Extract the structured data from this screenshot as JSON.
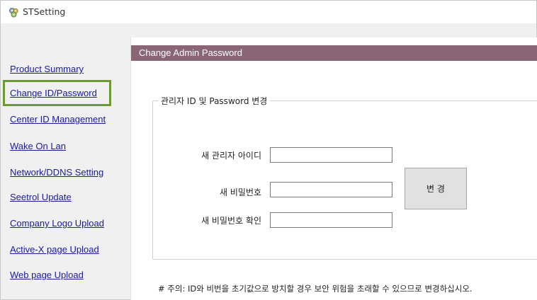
{
  "window": {
    "title": "STSetting",
    "icon": "gear-cluster-icon"
  },
  "sidebar": {
    "items": [
      {
        "label": "Product Summary"
      },
      {
        "label": "Change ID/Password",
        "selected": true
      },
      {
        "label": "Center ID Management"
      },
      {
        "label": "Wake On Lan"
      },
      {
        "label": "Network/DDNS Setting"
      },
      {
        "label": "Seetrol Update"
      },
      {
        "label": "Company Logo Upload"
      },
      {
        "label": "Active-X page Upload"
      },
      {
        "label": "Web page Upload"
      }
    ],
    "highlight_color": "#6e9a35"
  },
  "main": {
    "header_title": "Change Admin Password",
    "header_color": "#8a6575",
    "group_title": "관리자 ID 및 Password 변경",
    "fields": [
      {
        "label": "새 관리자 아이디",
        "value": ""
      },
      {
        "label": "새 비밀번호",
        "value": ""
      },
      {
        "label": "새 비밀번호 확인",
        "value": ""
      }
    ],
    "change_button": "변  경",
    "notice": "# 주의: ID와 비번을 초기값으로 방치할 경우 보안 위험을 초래할 수 있으므로 변경하십시오."
  }
}
